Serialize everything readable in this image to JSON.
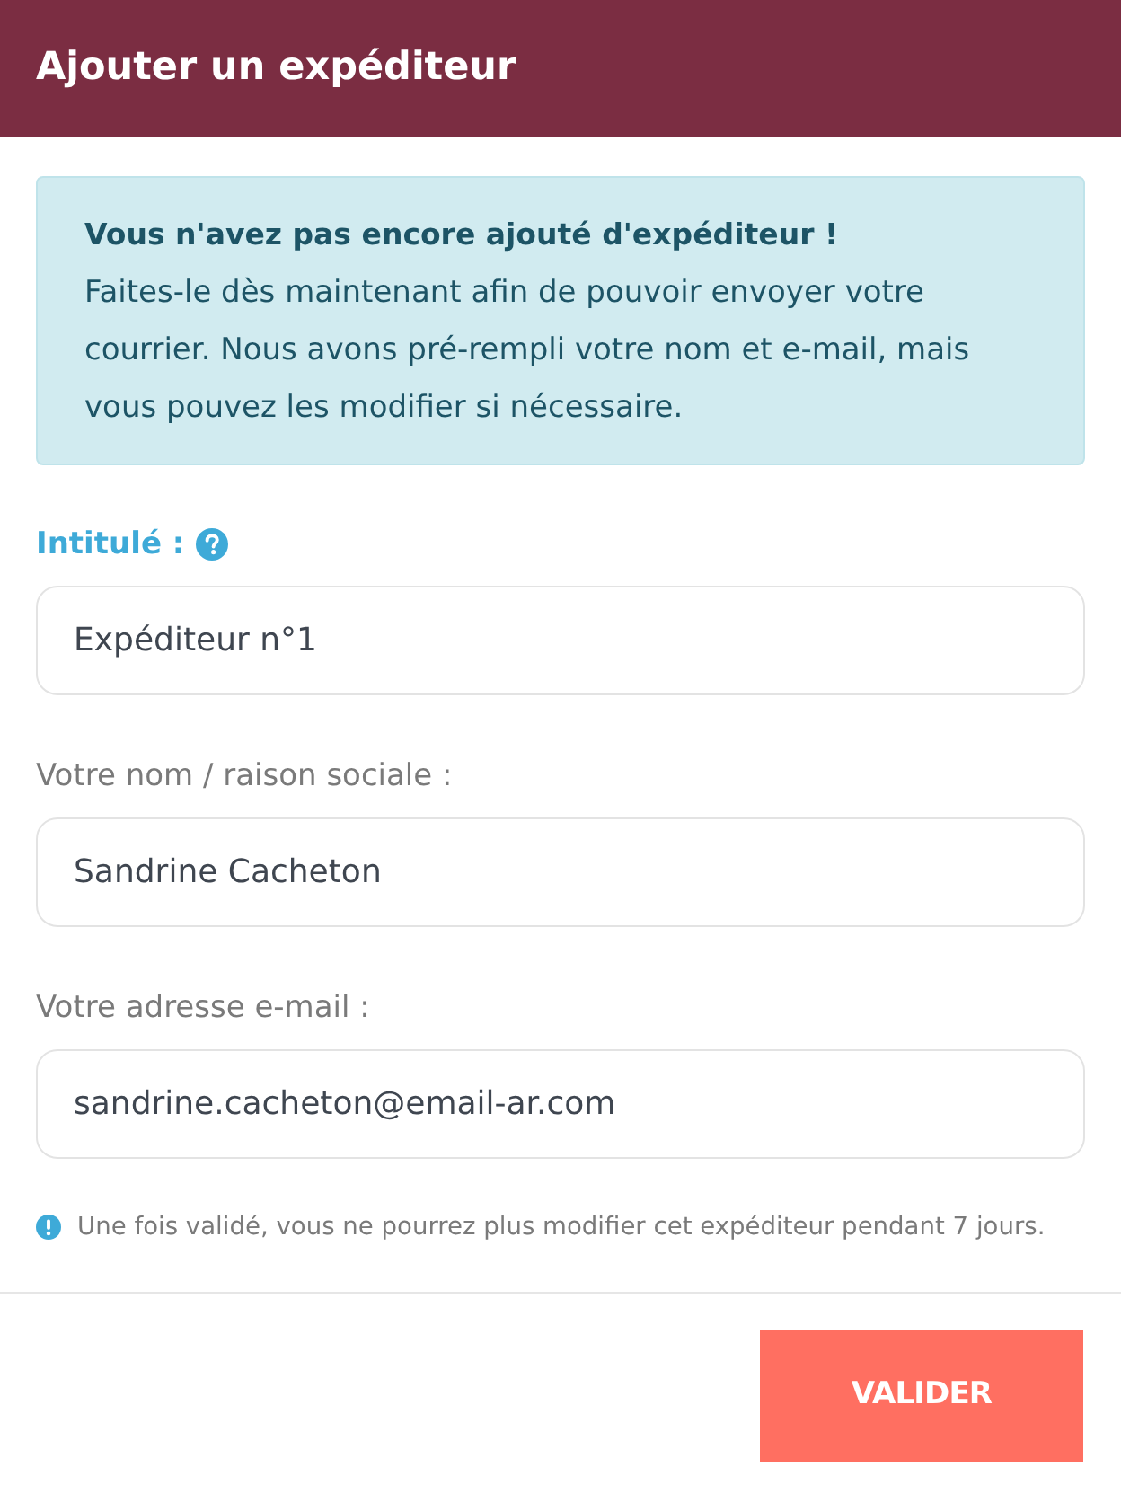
{
  "dialog": {
    "title": "Ajouter un expéditeur"
  },
  "alert": {
    "title": "Vous n'avez pas encore ajouté d'expéditeur !",
    "text": "Faites-le dès maintenant afin de pouvoir envoyer votre courrier. Nous avons pré-rempli votre nom et e-mail, mais vous pouvez les modifier si nécessaire."
  },
  "fields": [
    {
      "kind": "primary",
      "label": "Intitulé :",
      "value": "Expéditeur n°1"
    },
    {
      "kind": "standard",
      "label": "Votre nom / raison sociale :",
      "value": "Sandrine Cacheton"
    },
    {
      "kind": "standard",
      "label": "Votre adresse e-mail :",
      "value": "sandrine.cacheton@email-ar.com"
    }
  ],
  "note": {
    "text": "Une fois validé, vous ne pourrez plus modifier cet expéditeur pendant 7 jours."
  },
  "submit_button": {
    "label": "VALIDER"
  }
}
